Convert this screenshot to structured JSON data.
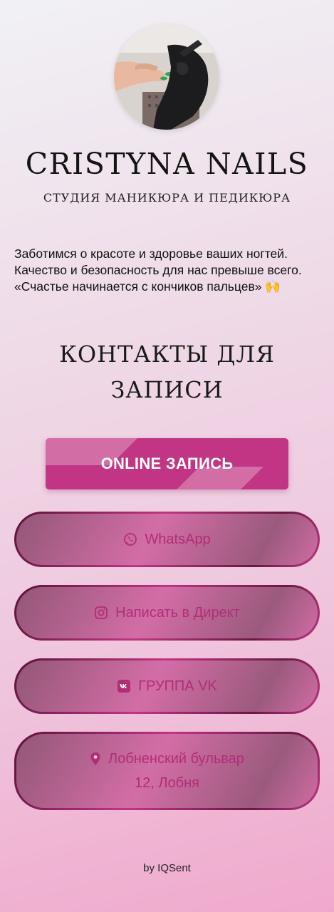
{
  "profile": {
    "brand_name": "CRISTYNA NAILS",
    "tagline": "СТУДИЯ МАНИКЮРА И ПЕДИКЮРА",
    "intro_text": "Заботимся о красоте и здоровье ваших ногтей. Качество и безопасность для нас превыше всего. «Счастье начинается с кончиков пальцев» 🙌"
  },
  "contacts": {
    "title": "КОНТАКТЫ ДЛЯ ЗАПИСИ",
    "online_button": "ONLINE ЗАПИСЬ",
    "links": {
      "whatsapp": "WhatsApp",
      "instagram": "Написать в Директ",
      "vk": "ГРУППА VK",
      "address_line1": "Лобненский бульвар",
      "address_line2": "12, Лобня"
    }
  },
  "footer": {
    "text": "by IQSent"
  },
  "colors": {
    "accent": "#c13584",
    "accent_dark": "#5a1238",
    "link_text": "#b22d78"
  },
  "icons": {
    "whatsapp": "whatsapp-icon",
    "instagram": "instagram-icon",
    "vk": "vk-icon",
    "location": "location-pin-icon"
  }
}
